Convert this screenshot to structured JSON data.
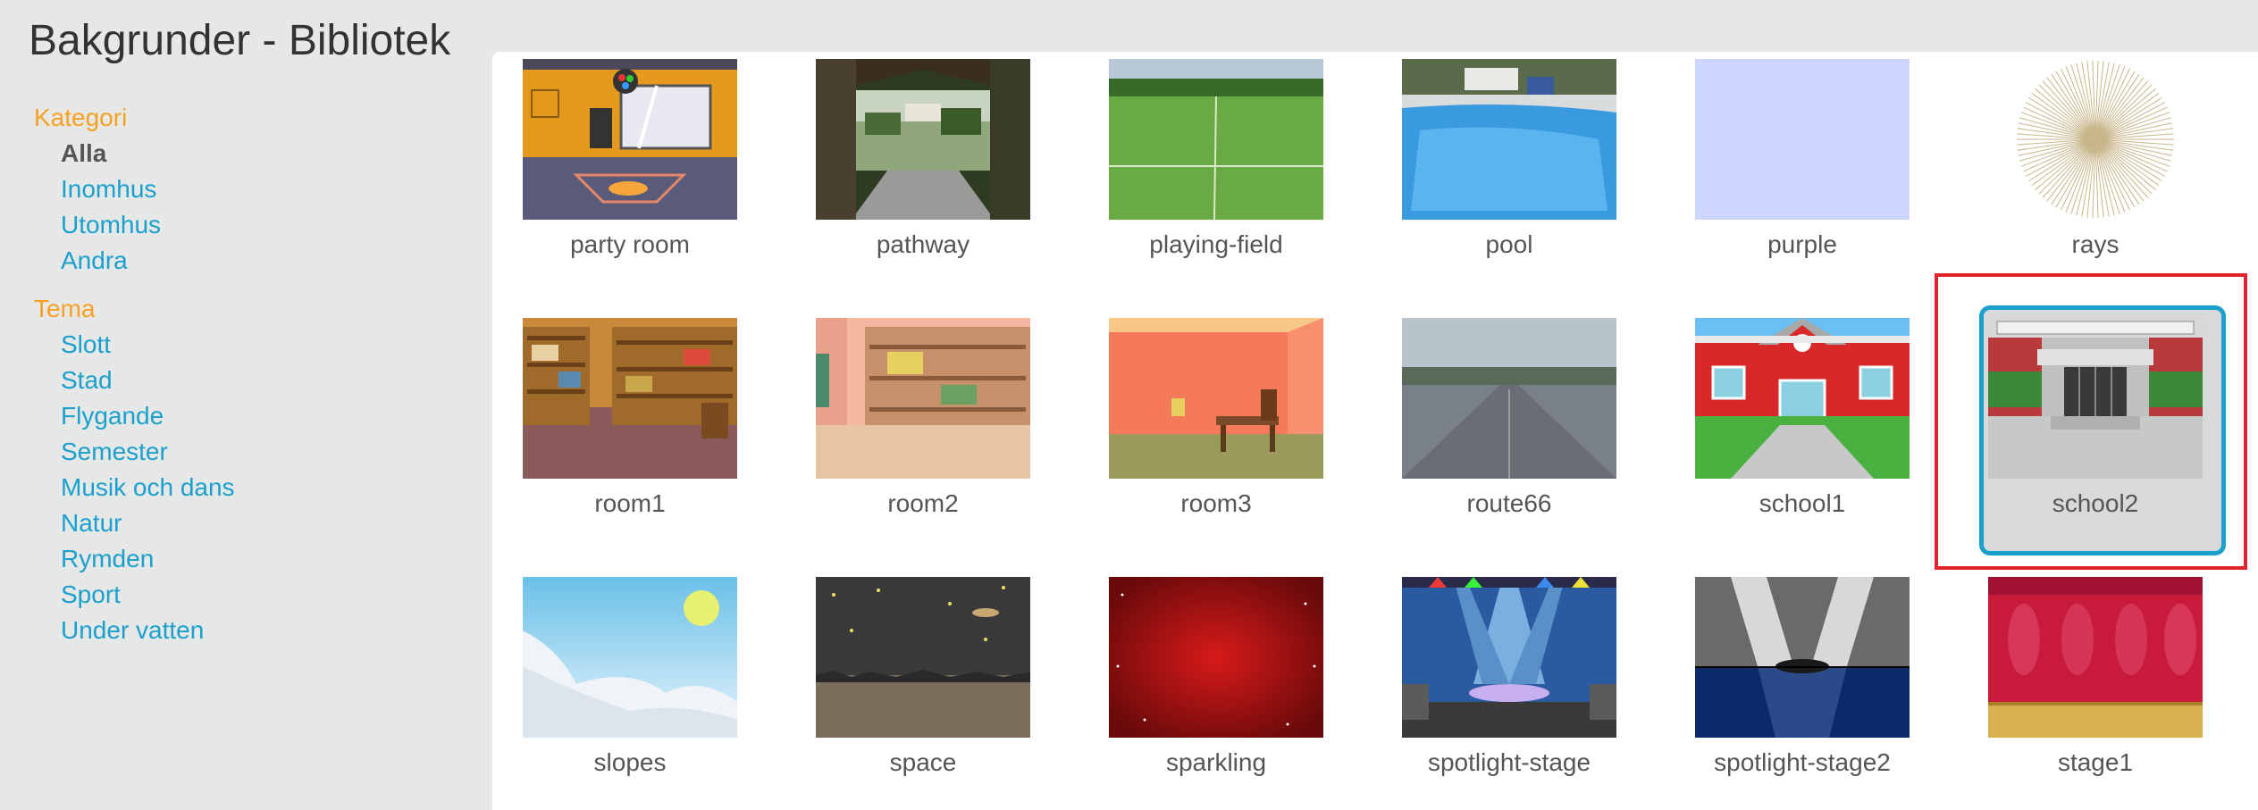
{
  "title": "Bakgrunder - Bibliotek",
  "sidebar": {
    "category_heading": "Kategori",
    "categories": [
      "Alla",
      "Inomhus",
      "Utomhus",
      "Andra"
    ],
    "selected_category": "Alla",
    "theme_heading": "Tema",
    "themes": [
      "Slott",
      "Stad",
      "Flygande",
      "Semester",
      "Musik och dans",
      "Natur",
      "Rymden",
      "Sport",
      "Under vatten"
    ]
  },
  "library": {
    "items": [
      {
        "name": "party room",
        "icon": "party-room-thumbnail"
      },
      {
        "name": "pathway",
        "icon": "pathway-thumbnail"
      },
      {
        "name": "playing-field",
        "icon": "playing-field-thumbnail"
      },
      {
        "name": "pool",
        "icon": "pool-thumbnail"
      },
      {
        "name": "purple",
        "icon": "purple-thumbnail"
      },
      {
        "name": "rays",
        "icon": "rays-thumbnail"
      },
      {
        "name": "room1",
        "icon": "room1-thumbnail"
      },
      {
        "name": "room2",
        "icon": "room2-thumbnail"
      },
      {
        "name": "room3",
        "icon": "room3-thumbnail"
      },
      {
        "name": "route66",
        "icon": "route66-thumbnail"
      },
      {
        "name": "school1",
        "icon": "school1-thumbnail"
      },
      {
        "name": "school2",
        "icon": "school2-thumbnail",
        "selected": true
      },
      {
        "name": "slopes",
        "icon": "slopes-thumbnail"
      },
      {
        "name": "space",
        "icon": "space-thumbnail"
      },
      {
        "name": "sparkling",
        "icon": "sparkling-thumbnail"
      },
      {
        "name": "spotlight-stage",
        "icon": "spotlight-stage-thumbnail"
      },
      {
        "name": "spotlight-stage2",
        "icon": "spotlight-stage2-thumbnail"
      },
      {
        "name": "stage1",
        "icon": "stage1-thumbnail"
      }
    ]
  },
  "colors": {
    "accent": "#1ba0cd",
    "section_heading": "#f7a022",
    "highlight": "#e0222b",
    "background": "#e6e8e8"
  }
}
